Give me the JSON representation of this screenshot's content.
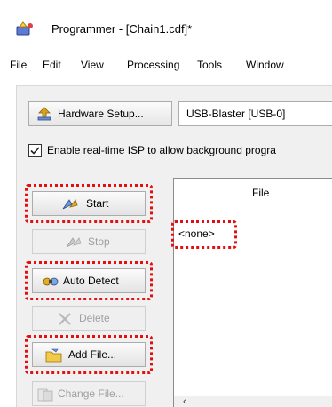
{
  "window": {
    "title": "Programmer - [Chain1.cdf]*"
  },
  "menu": {
    "items": [
      "File",
      "Edit",
      "View",
      "Processing",
      "Tools",
      "Window"
    ]
  },
  "toolbar": {
    "hardware_setup_label": "Hardware Setup...",
    "hardware_value": "USB-Blaster [USB-0]",
    "isp_checkbox_label": "Enable real-time ISP to allow background progra",
    "isp_checked": true
  },
  "side_buttons": {
    "start": "Start",
    "stop": "Stop",
    "auto_detect": "Auto Detect",
    "delete": "Delete",
    "add_file": "Add File...",
    "change_file": "Change File..."
  },
  "table": {
    "file_header": "File",
    "rows": [
      "<none>"
    ]
  },
  "colors": {
    "highlight": "#e01010",
    "panel_bg": "#f0f0f0"
  }
}
